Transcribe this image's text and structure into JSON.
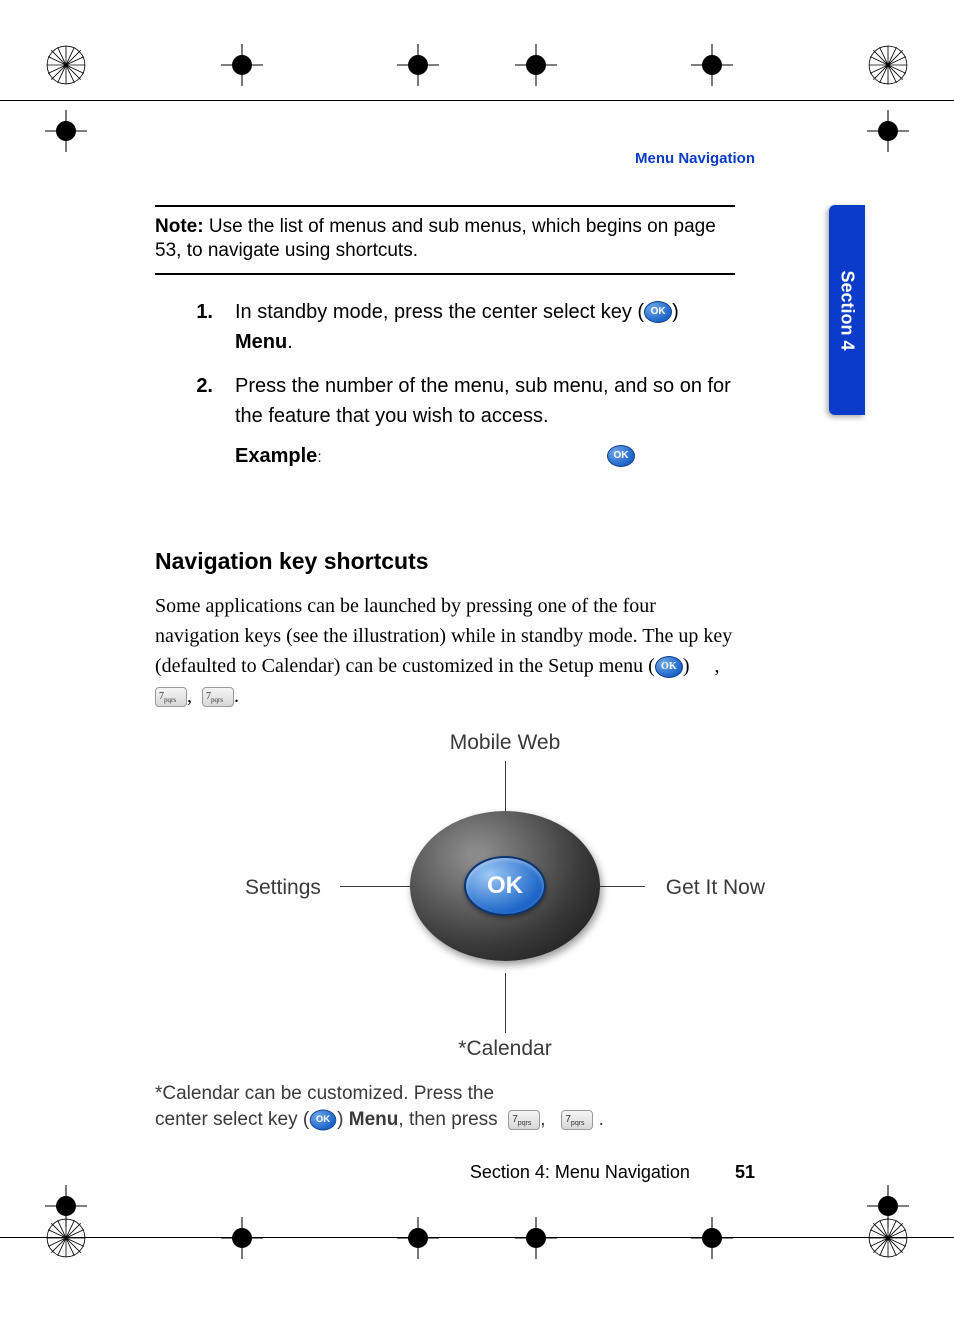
{
  "header": {
    "running_head": "Menu Navigation"
  },
  "tab": {
    "label": "Section 4"
  },
  "note": {
    "label": "Note:",
    "text": "Use the list of menus and sub menus, which begins on page 53, to navigate using shortcuts."
  },
  "steps": [
    {
      "num": "1.",
      "pre": "In standby mode, press the center select key (",
      "post": ") ",
      "menu_word": "Menu",
      "tail": "."
    },
    {
      "num": "2.",
      "text": "Press the number of the menu, sub menu, and so on for the feature that you wish to access."
    }
  ],
  "example": {
    "label": "Example",
    "colon": ":"
  },
  "subheading": "Navigation key shortcuts",
  "paragraph": {
    "pre": "Some applications can be launched by pressing one of the four navigation keys (see the illustration) while in standby mode. The up key (defaulted to Calendar) can be customized in the Setup menu (",
    "post": ")",
    "comma1": ",",
    "comma2": ",",
    "period": "."
  },
  "illustration": {
    "up": "Mobile Web",
    "left": "Settings",
    "right": "Get It Now",
    "down": "*Calendar",
    "ok": "OK"
  },
  "footnote": {
    "l1_pre": "*Calendar can be customized.  Press the",
    "l2_pre": "center select key (",
    "l2_mid": ") ",
    "menu_word": "Menu",
    "l2_post": ", then press",
    "comma": ",",
    "period": "."
  },
  "footer": {
    "text": "Section 4: Menu Navigation",
    "page": "51"
  },
  "icons": {
    "ok": "OK",
    "key7": "7",
    "key7_sub": "pqrs"
  }
}
